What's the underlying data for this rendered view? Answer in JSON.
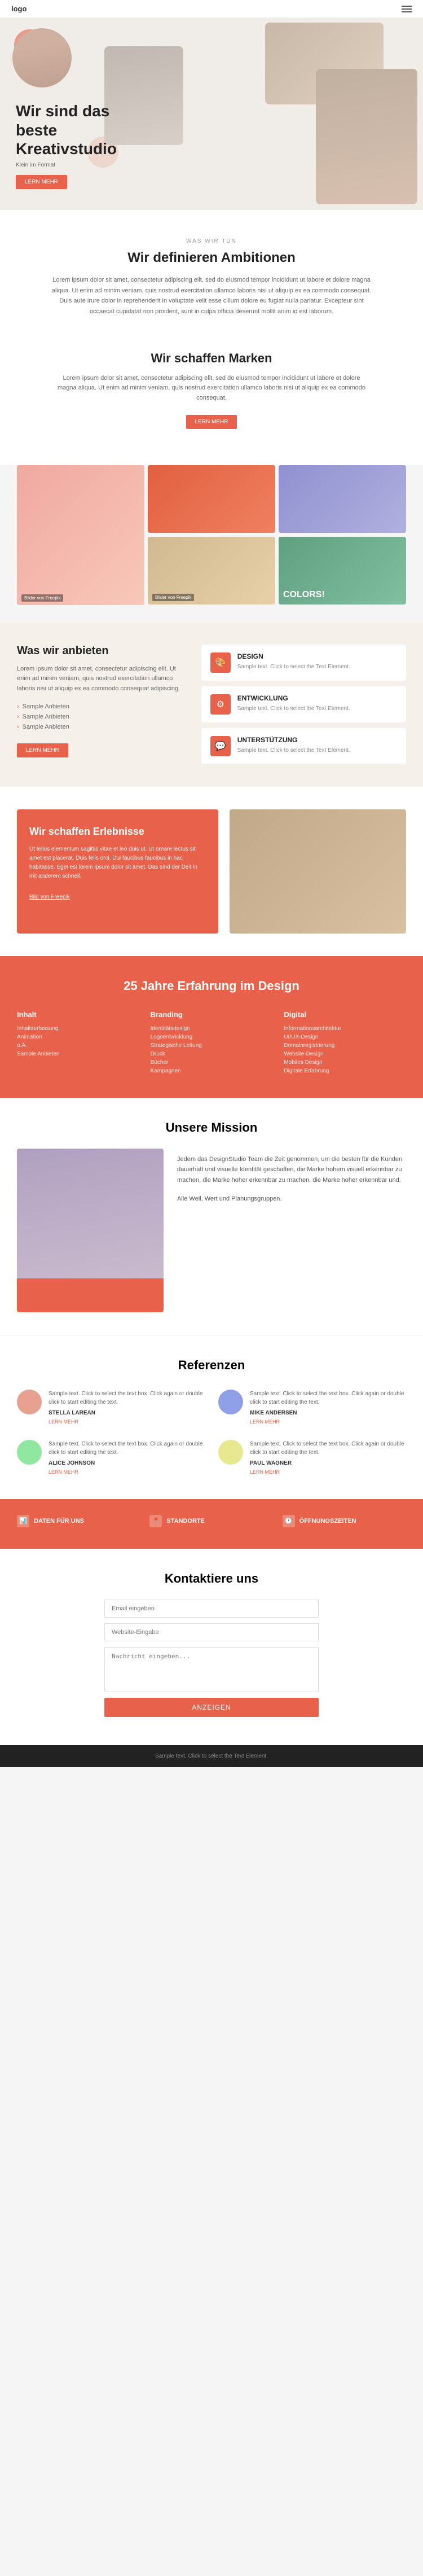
{
  "header": {
    "logo": "logo",
    "menu_icon": "≡"
  },
  "hero": {
    "title": "Wir sind das beste Kreativstudio",
    "subtitle": "Klein im Format",
    "cta_label": "LERN MEHR"
  },
  "define_section": {
    "heading": "Wir definieren Ambitionen",
    "text": "Lorem ipsum dolor sit amet, consectetur adipiscing elit, sed do eiusmod tempor incididunt ut labore et dolore magna aliqua. Ut enim ad minim veniam, quis nostrud exercitation ullamco laboris nisi ut aliquip ex ea commodo consequat. Duis aute irure dolor in reprehenderit in voluptate velit esse cillum dolore eu fugiat nulla pariatur. Excepteur sint occaecat cupidatat non proident, sunt in culpa officia deserunt mollit anim id est laborum."
  },
  "marken_section": {
    "heading": "Wir schaffen Marken",
    "text": "Lorem ipsum dolor sit amet, consectetur adipiscing elit, sed do eiusmod tempor incididunt ut labore et dolore magna aliqua. Ut enim ad minim veniam, quis nostrud exercitation ullamco laboris nisi ut aliquip ex ea commodo consequat.",
    "cta_label": "LERN MEHR",
    "images": [
      {
        "label": "Bilder von Freepik",
        "color": "color-pink"
      },
      {
        "label": "",
        "color": "color-orange-dark"
      },
      {
        "label": "",
        "color": "color-blue"
      },
      {
        "label": "",
        "color": "color-warm"
      },
      {
        "label": "COLORS!",
        "color": "color-green"
      }
    ]
  },
  "anbieten_section": {
    "heading": "Was wir anbieten",
    "text": "Lorem ipsum dolor sit amet, consectetur adipiscing elit. Ut enim ad minim veniam, quis nostrud exercitation ullamco laboris nisi ut aliquip ex ea commodo consequat adipiscing.",
    "list": [
      "Sample Anbieten",
      "Sample Anbieten",
      "Sample Anbieten"
    ],
    "cta_label": "LERN MEHR",
    "services": [
      {
        "icon": "🎨",
        "title": "DESIGN",
        "text": "Sample text. Click to select the Text Element."
      },
      {
        "icon": "⚙",
        "title": "ENTWICKLUNG",
        "text": "Sample text. Click to select the Text Element."
      },
      {
        "icon": "💬",
        "title": "UNTERSTÜTZUNG",
        "text": "Sample text. Click to select the Text Element."
      }
    ]
  },
  "erlebnisse_section": {
    "heading": "Wir schaffen Erlebnisse",
    "text": "Ut tellus elementum sagittis vitae et leo duis ut. Ut ornare lectus sit amet est placerat. Duis felis orci. Dui faucibus faucibus in hac habitasse. Eget est lorem ipsum dolor sit amet. Das sind der Deit in mit anderem schnell.",
    "link": "Bild von Freepik"
  },
  "jahre_section": {
    "heading": "25 Jahre Erfahrung im Design",
    "columns": [
      {
        "title": "Inhalt",
        "items": [
          "Inhaltserfassung",
          "Animation",
          "o.Ä.",
          "Sample Anbieten"
        ]
      },
      {
        "title": "Branding",
        "items": [
          "Identitätsdesign",
          "Logoentwicklung",
          "Strategische Leitung",
          "Druck",
          "Bücher",
          "Kampagnen"
        ]
      },
      {
        "title": "Digital",
        "items": [
          "Informationsarchitektur",
          "UI/UX-Design",
          "Domainregistrierung",
          "Website-Design",
          "Mobiles Design",
          "Digitale Erfahrung"
        ]
      }
    ]
  },
  "mission_section": {
    "heading": "Unsere Mission",
    "text1": "Jedem das DesignStudio Team die Zeit genommen, um die besten für die Kunden dauerhaft und visuelle Identität geschaffen, die Marke hohem visuell erkennbar zu machen, die Marke hoher erkennbar zu machen. die Marke hoher erkennbar und.",
    "text2": "Alle Weil, Wert und Planungsgruppen."
  },
  "referenzen_section": {
    "heading": "Referenzen",
    "reviews": [
      {
        "text": "Sample text. Click to select the text box. Click again or double click to start editing the text.",
        "name": "STELLA LAREAN",
        "link": "LERN MEHR",
        "color": "c1"
      },
      {
        "text": "Sample text. Click to select the text box. Click again or double click to start editing the text.",
        "name": "MIKE ANDERSEN",
        "link": "LERN MEHR",
        "color": "c2"
      },
      {
        "text": "Sample text. Click to select the text box. Click again or double click to start editing the text.",
        "name": "ALICE JOHNSON",
        "link": "LERN MEHR",
        "color": "c3"
      },
      {
        "text": "Sample text. Click to select the text box. Click again or double click to start editing the text.",
        "name": "PAUL WAGNER",
        "link": "LERN MEHR",
        "color": "c4"
      }
    ]
  },
  "footer_nav": {
    "columns": [
      {
        "title": "DATEN FÜR UNS",
        "icon": "📊",
        "items": []
      },
      {
        "title": "STANDORTE",
        "icon": "📍",
        "items": []
      },
      {
        "title": "ÖFFNUNGSZEITEN",
        "icon": "🕐",
        "items": []
      }
    ]
  },
  "kontakt_section": {
    "heading": "Kontaktiere uns",
    "email_placeholder": "Email eingeben",
    "name_placeholder": "Website-Eingabe",
    "message_placeholder": "Nachricht eingeben...",
    "submit_label": "ANZEIGEN"
  },
  "footer_bottom": {
    "text": "Sample text. Click to select the Text Element."
  }
}
